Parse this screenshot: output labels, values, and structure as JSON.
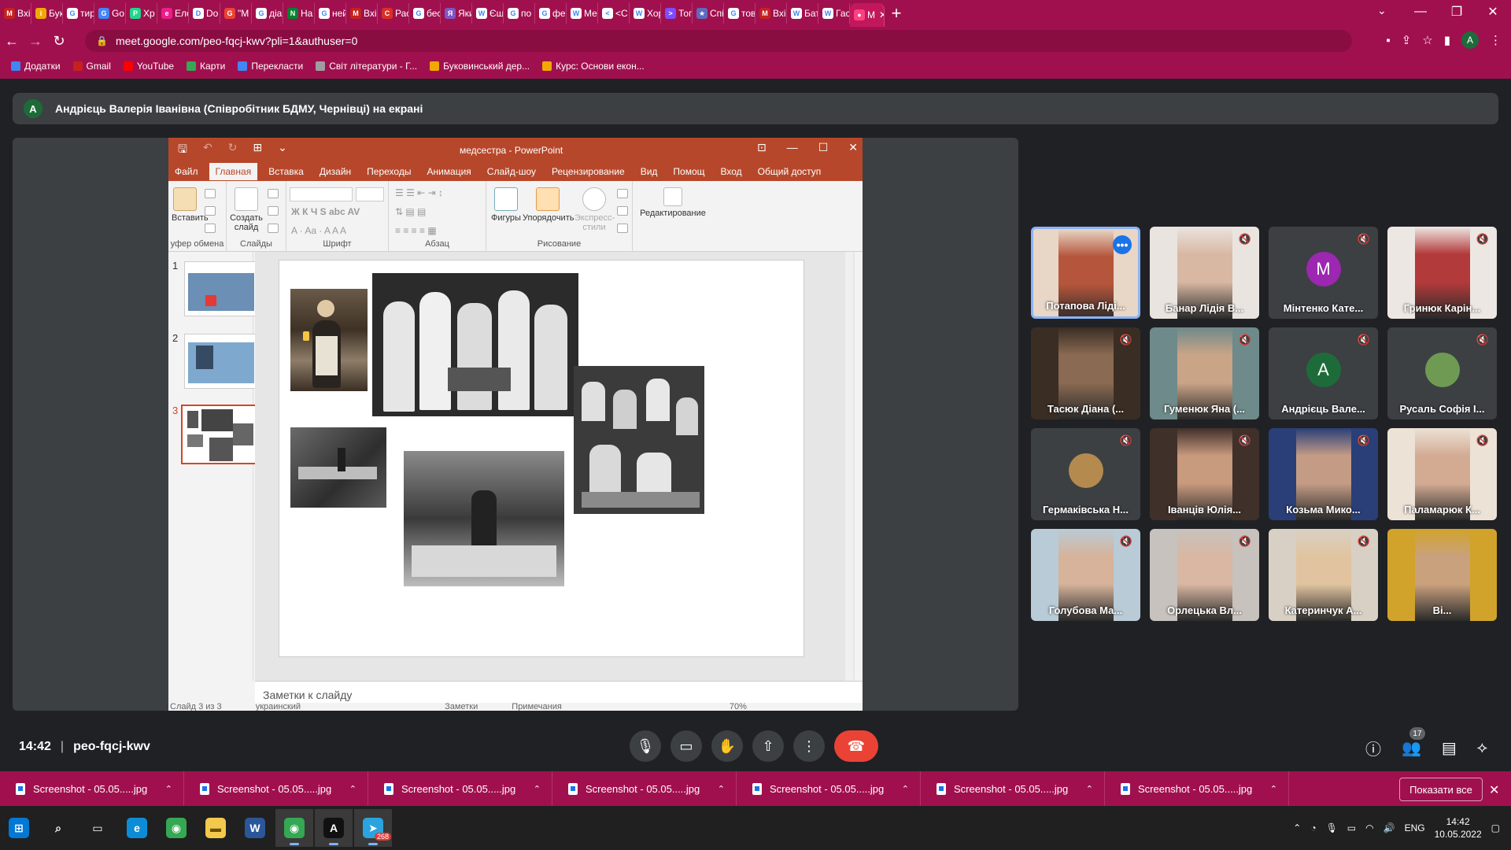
{
  "browser": {
    "tabs": [
      {
        "label": "Вхі",
        "icon": "gmail-icon",
        "color": "#c5221f",
        "letter": "M"
      },
      {
        "label": "Бук",
        "icon": "yellow-logo-icon",
        "color": "#f1a900",
        "letter": "i"
      },
      {
        "label": "тир",
        "icon": "google-icon",
        "color": "#ffffff",
        "letter": "G"
      },
      {
        "label": "Go",
        "icon": "translate-icon",
        "color": "#4285f4",
        "letter": "G"
      },
      {
        "label": "Хр",
        "icon": "pycharm-icon",
        "color": "#21d789",
        "letter": "P"
      },
      {
        "label": "Еле",
        "icon": "purple-logo-icon",
        "color": "#e91e8c",
        "letter": "e"
      },
      {
        "label": "Do",
        "icon": "doc-icon",
        "color": "#ffffff",
        "letter": "D"
      },
      {
        "label": "\"M",
        "icon": "google-icon",
        "color": "#ea4335",
        "letter": "G"
      },
      {
        "label": "діа",
        "icon": "google-icon",
        "color": "#ffffff",
        "letter": "G"
      },
      {
        "label": "На",
        "icon": "meet-icon",
        "color": "#00832d",
        "letter": "N"
      },
      {
        "label": "ней",
        "icon": "google-icon",
        "color": "#ffffff",
        "letter": "G"
      },
      {
        "label": "Вхі",
        "icon": "gmail-icon",
        "color": "#c5221f",
        "letter": "M"
      },
      {
        "label": "Рас",
        "icon": "red-c-icon",
        "color": "#d93025",
        "letter": "C"
      },
      {
        "label": "бес",
        "icon": "google-icon",
        "color": "#ffffff",
        "letter": "G"
      },
      {
        "label": "Яки",
        "icon": "purple-icon",
        "color": "#7e57c2",
        "letter": "Я"
      },
      {
        "label": "Єщ",
        "icon": "wikipedia-icon",
        "color": "#ffffff",
        "letter": "W"
      },
      {
        "label": "по",
        "icon": "google-icon",
        "color": "#ffffff",
        "letter": "G"
      },
      {
        "label": "фе",
        "icon": "google-icon",
        "color": "#ffffff",
        "letter": "G"
      },
      {
        "label": "Ме",
        "icon": "wikipedia-icon",
        "color": "#ffffff",
        "letter": "W"
      },
      {
        "label": "<С",
        "icon": "circle-icon",
        "color": "#ffffff",
        "letter": "<"
      },
      {
        "label": "Хор",
        "icon": "wikipedia-icon",
        "color": "#ffffff",
        "letter": "W"
      },
      {
        "label": "Тог",
        "icon": "arrow-icon",
        "color": "#7c4dff",
        "letter": ">"
      },
      {
        "label": "Спі",
        "icon": "star-icon",
        "color": "#5c6bc0",
        "letter": "★"
      },
      {
        "label": "тов",
        "icon": "google-icon",
        "color": "#ffffff",
        "letter": "G"
      },
      {
        "label": "Вхі",
        "icon": "gmail-icon",
        "color": "#c5221f",
        "letter": "M"
      },
      {
        "label": "Бат",
        "icon": "wikipedia-icon",
        "color": "#ffffff",
        "letter": "W"
      },
      {
        "label": "Гас",
        "icon": "wikipedia-icon",
        "color": "#ffffff",
        "letter": "W"
      },
      {
        "label": "M",
        "icon": "meet-icon",
        "color": "#ff4081",
        "letter": "●",
        "active": true
      }
    ],
    "url": "meet.google.com/peo-fqcj-kwv?pli=1&authuser=0",
    "profile_letter": "A",
    "bookmarks": [
      {
        "label": "Додатки",
        "color": "#4285f4"
      },
      {
        "label": "Gmail",
        "color": "#c5221f"
      },
      {
        "label": "YouTube",
        "color": "#ff0000"
      },
      {
        "label": "Карти",
        "color": "#34a853"
      },
      {
        "label": "Перекласти",
        "color": "#4285f4"
      },
      {
        "label": "Світ літератури - Г...",
        "color": "#9e9e9e"
      },
      {
        "label": "Буковинський дер...",
        "color": "#f1a900"
      },
      {
        "label": "Курс: Основи екон...",
        "color": "#f1a900"
      }
    ]
  },
  "meet": {
    "presenter_letter": "A",
    "presenter_banner": "Андрієць Валерія Іванівна (Співробітник БДМУ, Чернівці) на екрані",
    "time": "14:42",
    "meeting_code": "peo-fqcj-kwv",
    "participant_count": "17",
    "participants": [
      {
        "name": "Потапова Лідi...",
        "speaking": true,
        "type": "video",
        "tone": "#b5553b",
        "bg": "#e8d6c6"
      },
      {
        "name": "Банар Лідія В...",
        "muted": true,
        "type": "video",
        "tone": "#d9b8a3",
        "bg": "#e9e4df"
      },
      {
        "name": "Мінтенко Кате...",
        "muted": true,
        "type": "letter",
        "letter": "M",
        "color": "#9c27b0"
      },
      {
        "name": "Гринюк Карін...",
        "muted": true,
        "type": "video",
        "tone": "#b33a3a",
        "bg": "#ede7e3"
      },
      {
        "name": "Тасюк Діана (...",
        "muted": true,
        "type": "video",
        "tone": "#8a6a52",
        "bg": "#3a2d24"
      },
      {
        "name": "Гуменюк Яна (...",
        "muted": true,
        "type": "video",
        "tone": "#caa487",
        "bg": "#6e8a8a"
      },
      {
        "name": "Андрієць Вале...",
        "muted": true,
        "type": "letter",
        "letter": "A",
        "color": "#1e6b3a"
      },
      {
        "name": "Русаль Софія І...",
        "muted": true,
        "type": "photo",
        "color": "#6f9a53"
      },
      {
        "name": "Гермаківська Н...",
        "muted": true,
        "type": "photo",
        "color": "#b48a4f"
      },
      {
        "name": "Іванців Юлія...",
        "muted": true,
        "type": "video",
        "tone": "#c89a7e",
        "bg": "#40302a"
      },
      {
        "name": "Козьма Мико...",
        "muted": true,
        "type": "video",
        "tone": "#c49c86",
        "bg": "#2a3f78"
      },
      {
        "name": "Паламарюк К...",
        "muted": true,
        "type": "video",
        "tone": "#d3ab93",
        "bg": "#ece2d6"
      },
      {
        "name": "Голубова Ма...",
        "muted": true,
        "type": "video",
        "tone": "#d6b39a",
        "bg": "#b9cbd6"
      },
      {
        "name": "Орлецька Вл...",
        "muted": true,
        "type": "video",
        "tone": "#d9b7a2",
        "bg": "#c7c2bd"
      },
      {
        "name": "Катеринчук А...",
        "muted": true,
        "type": "video",
        "tone": "#e1c49f",
        "bg": "#d8d0c4"
      },
      {
        "name": "Ві...",
        "muted": false,
        "type": "video",
        "tone": "#caa17d",
        "bg": "#d1a32b"
      }
    ]
  },
  "ppt": {
    "window_title": "медсестра - PowerPoint",
    "menu": [
      "Файл",
      "Главная",
      "Вставка",
      "Дизайн",
      "Переходы",
      "Анимация",
      "Слайд-шоу",
      "Рецензирование",
      "Вид",
      "Помощ",
      "Вход",
      "Общий доступ"
    ],
    "active_menu": "Главная",
    "ribbon": {
      "paste": "Вставить",
      "clipboard": "уфер обмена",
      "new_slide_1": "Создать",
      "new_slide_2": "слайд",
      "slides": "Слайды",
      "font": "Шрифт",
      "paragraph": "Абзац",
      "shapes": "Фигуры",
      "arrange": "Упорядочить",
      "styles_1": "Экспресс-",
      "styles_2": "стили",
      "drawing": "Рисование",
      "editing": "Редактирование"
    },
    "slide_numbers": [
      "1",
      "2",
      "3"
    ],
    "notes_placeholder": "Заметки к слайду",
    "status": {
      "slide_of": "Слайд 3 из 3",
      "language": "украинский",
      "notes": "Заметки",
      "comments": "Примечания",
      "zoom": "70%"
    }
  },
  "downloads": {
    "items": [
      "Screenshot - 05.05.....jpg",
      "Screenshot - 05.05.....jpg",
      "Screenshot - 05.05.....jpg",
      "Screenshot - 05.05.....jpg",
      "Screenshot - 05.05.....jpg",
      "Screenshot - 05.05.....jpg",
      "Screenshot - 05.05.....jpg"
    ],
    "show_all": "Показати все"
  },
  "taskbar": {
    "apps": [
      {
        "icon": "windows-start-icon",
        "color": "#0078d4",
        "letter": "⊞"
      },
      {
        "icon": "search-icon",
        "color": "transparent",
        "letter": "⌕"
      },
      {
        "icon": "task-view-icon",
        "color": "transparent",
        "letter": "▭"
      },
      {
        "icon": "edge-icon",
        "color": "#0c8cd6",
        "letter": "e"
      },
      {
        "icon": "chrome-icon",
        "color": "#34a853",
        "letter": "◉"
      },
      {
        "icon": "file-explorer-icon",
        "color": "#f2c94c",
        "letter": "▬"
      },
      {
        "icon": "word-icon",
        "color": "#2b579a",
        "letter": "W"
      },
      {
        "icon": "chrome-active-icon",
        "color": "#34a853",
        "letter": "◉",
        "active": true
      },
      {
        "icon": "app-a-icon",
        "color": "#111111",
        "letter": "A",
        "active": true
      },
      {
        "icon": "telegram-icon",
        "color": "#2aa3df",
        "letter": "➤",
        "badge": "268",
        "active": true
      }
    ],
    "language": "ENG",
    "time": "14:42",
    "date": "10.05.2022"
  }
}
